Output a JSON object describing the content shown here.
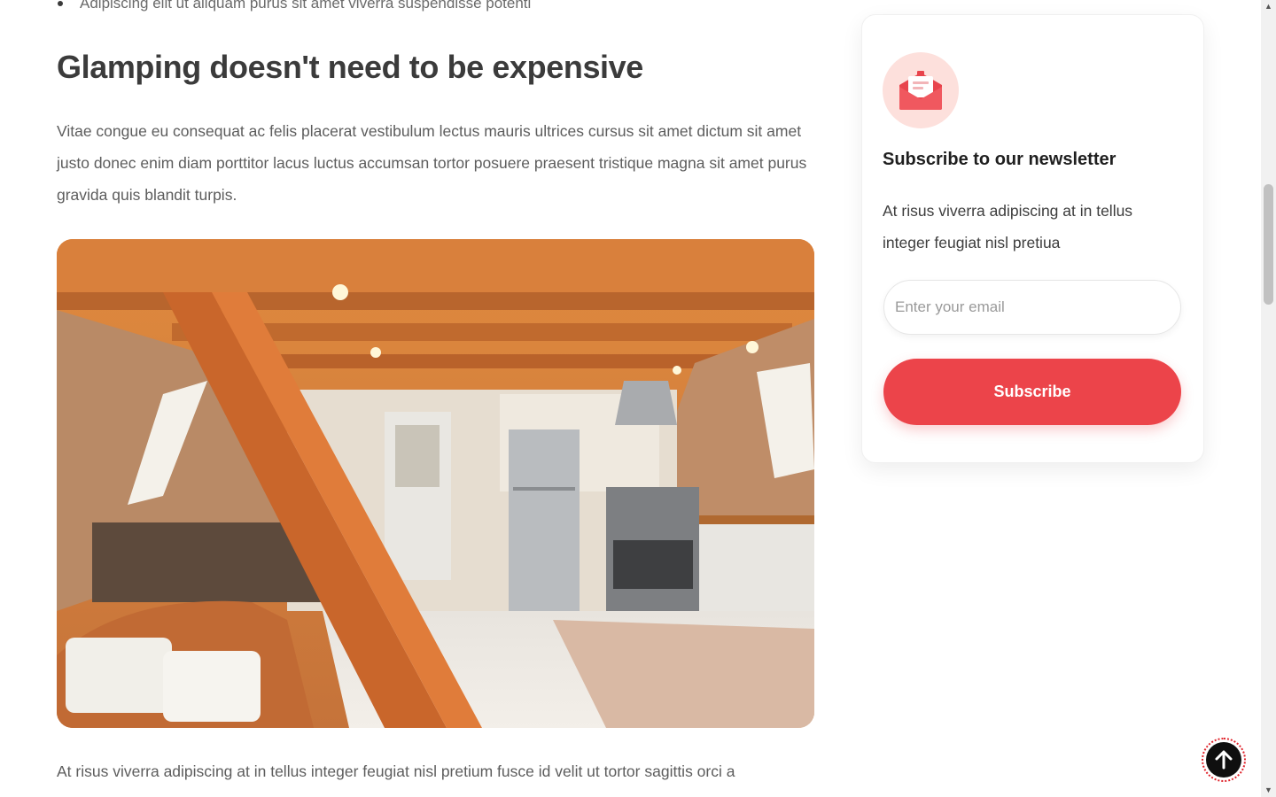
{
  "article": {
    "list_item": "Adipiscing elit ut aliquam purus sit amet viverra suspendisse potenti",
    "heading": "Glamping doesn't need to be expensive",
    "paragraph1": "Vitae congue eu consequat ac felis placerat vestibulum lectus mauris ultrices cursus sit amet dictum sit amet justo donec enim diam porttitor lacus luctus accumsan tortor posuere praesent tristique magna sit amet purus gravida quis blandit turpis.",
    "paragraph2": "At risus viverra adipiscing at in tellus integer feugiat nisl pretium fusce id velit ut tortor sagittis orci a"
  },
  "newsletter": {
    "title": "Subscribe to our newsletter",
    "description": "At risus viverra adipiscing at in tellus integer feugiat nisl pretiua",
    "email_placeholder": "Enter your email",
    "subscribe_label": "Subscribe",
    "icon": "envelope-icon",
    "accent_color": "#ec444a"
  },
  "back_to_top": {
    "icon": "arrow-up-icon"
  }
}
